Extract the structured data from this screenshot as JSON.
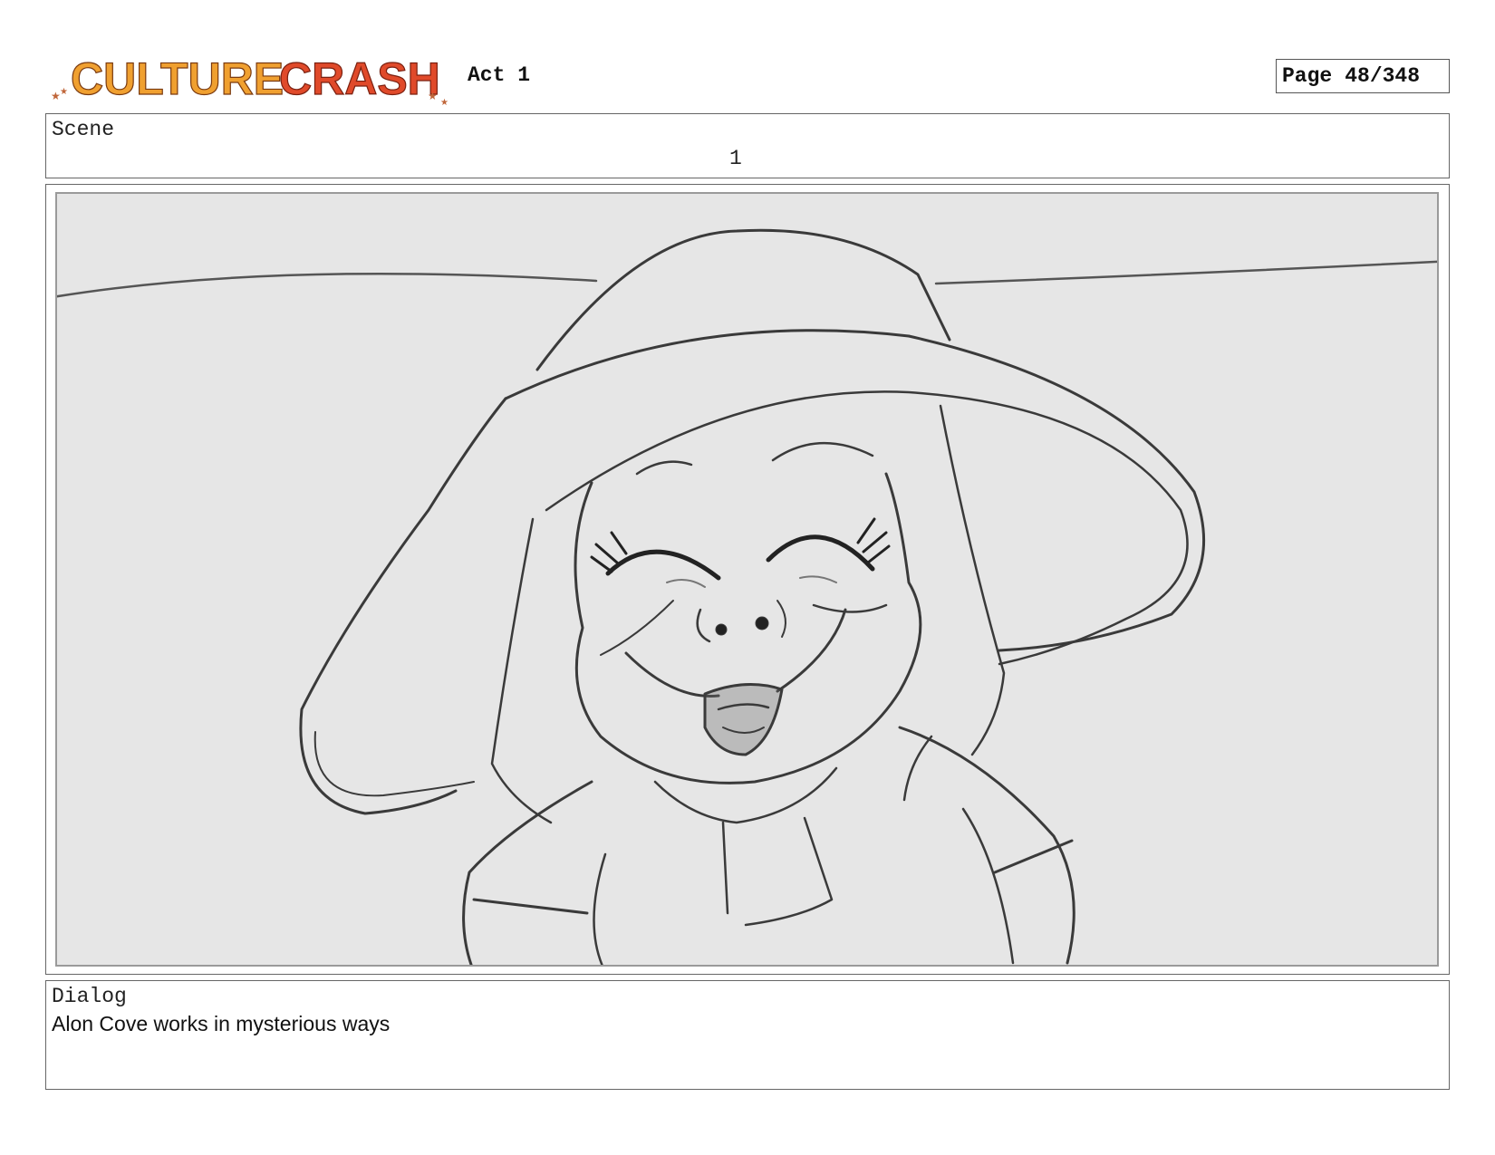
{
  "header": {
    "logo_text": "CULTURE CRASH",
    "act": "Act 1",
    "page_label": "Page",
    "page_number": "48/348"
  },
  "scene": {
    "label": "Scene",
    "number": "1"
  },
  "panel": {
    "image_name": "storyboard-sketch"
  },
  "dialog": {
    "label": "Dialog",
    "text": "Alon Cove works in mysterious ways"
  },
  "colors": {
    "logo_orange": "#f0a030",
    "logo_red": "#e04a2a",
    "panel_background": "#e6e6e6",
    "sketch_stroke": "#3a3a3a"
  }
}
